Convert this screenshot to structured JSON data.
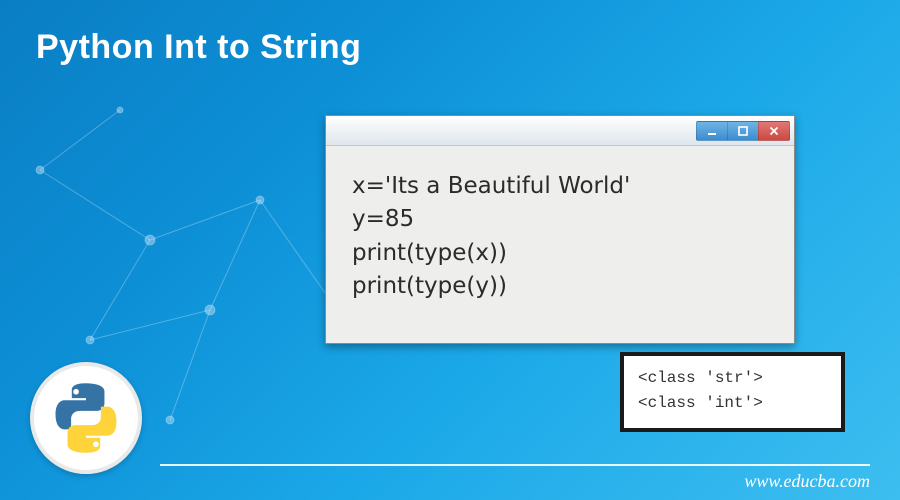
{
  "title": "Python Int to String",
  "code": {
    "line1": "x='Its a Beautiful World'",
    "line2": "y=85",
    "line3": "print(type(x))",
    "line4": "print(type(y))"
  },
  "output": {
    "line1": "<class 'str'>",
    "line2": "<class 'int'>"
  },
  "footer": {
    "url": "www.educba.com"
  },
  "logo": {
    "name": "python-logo"
  },
  "window_controls": {
    "minimize": "minimize",
    "maximize": "maximize",
    "close": "close"
  }
}
